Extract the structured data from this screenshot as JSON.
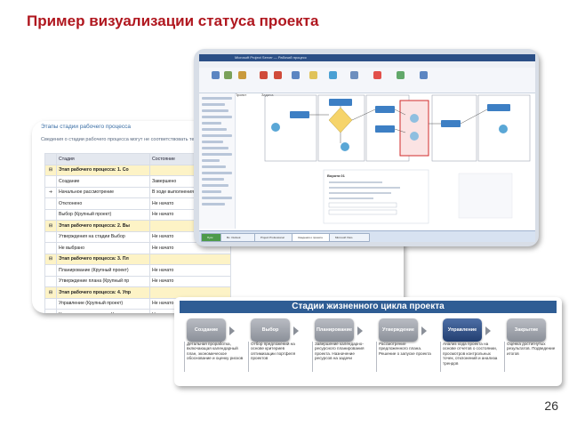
{
  "slide": {
    "title": "Пример визуализации статуса проекта",
    "page_number": "26"
  },
  "stages_table": {
    "caption": "Этапы стадии рабочего процесса",
    "description": "Сведения о стадии рабочего процесса могут не соответствовать теку",
    "headers": [
      "",
      "Стадия",
      "Состояние"
    ],
    "rows": [
      {
        "group": true,
        "icon": "⊟",
        "stage": "Этап рабочего процесса: 1. Co",
        "state": ""
      },
      {
        "group": false,
        "icon": "",
        "stage": "Создание",
        "state": "Завершено"
      },
      {
        "group": false,
        "icon": "➜",
        "stage": "Начальное рассмотрение",
        "state": "В ходе выполнения"
      },
      {
        "group": false,
        "icon": "",
        "stage": "Отклонено",
        "state": "Не начато"
      },
      {
        "group": false,
        "icon": "",
        "stage": "Выбор (Крупный проект)",
        "state": "Не начато"
      },
      {
        "group": true,
        "icon": "⊟",
        "stage": "Этап рабочего процесса: 2. Вы",
        "state": ""
      },
      {
        "group": false,
        "icon": "",
        "stage": "Утверждения на стадии Выбор",
        "state": "Не начато"
      },
      {
        "group": false,
        "icon": "",
        "stage": "Не выбрано",
        "state": "Не начато"
      },
      {
        "group": true,
        "icon": "⊟",
        "stage": "Этап рабочего процесса: 3. Пл",
        "state": ""
      },
      {
        "group": false,
        "icon": "",
        "stage": "Планирование (Крупный проект)",
        "state": "Не начато"
      },
      {
        "group": false,
        "icon": "",
        "stage": "Утверждение плана (Крупный пр",
        "state": "Не начато"
      },
      {
        "group": true,
        "icon": "⊟",
        "stage": "Этап рабочего процесса: 4. Упр",
        "state": ""
      },
      {
        "group": false,
        "icon": "",
        "stage": "Управление (Крупный проект)",
        "state": "Не начато"
      },
      {
        "group": false,
        "icon": "",
        "stage": "Утверждения на стадии Управле",
        "state": "Не начато"
      }
    ]
  },
  "screenshot": {
    "window_title": "Microsoft Project Server — Рабочий процесс",
    "taskbar": [
      "Пуск",
      "Вх. Outlook",
      "Project Professional",
      "Сведения о проекте",
      "Microsoft Visio"
    ],
    "ribbon_tabs": [
      "Файл",
      "Проект",
      "Задача"
    ],
    "panel_title": "Ворота 01"
  },
  "lifecycle": {
    "title": "Стадии жизненного цикла проекта",
    "stages": [
      {
        "label": "Создание",
        "active": false,
        "desc": "Детальная проработка, включающая календарный план, экономическое обоснование и оценку рисков"
      },
      {
        "label": "Выбор",
        "active": false,
        "desc": "Отбор предложений на основе критериев оптимизации портфеля проектов"
      },
      {
        "label": "Планирование",
        "active": false,
        "desc": "Завершение календарно-ресурсного планирования проекта. Назначение ресурсов на задачи"
      },
      {
        "label": "Утверждение плана",
        "active": false,
        "desc": "Рассмотрение предложенного плана. Решение о запуске проекта"
      },
      {
        "label": "Управление",
        "active": true,
        "desc": "Анализ хода проекта на основе отчетов о состоянии, просмотров контрольных точек, отклонений и анализа трендов"
      },
      {
        "label": "Закрытие проекта",
        "active": false,
        "desc": "Оценка достигнутых результатов. Подведение итогов"
      }
    ]
  },
  "colors": {
    "title": "#b0171f",
    "header_band": "#2f5d94",
    "active_stage": "#233f71",
    "group_row": "#fdf3c6"
  }
}
